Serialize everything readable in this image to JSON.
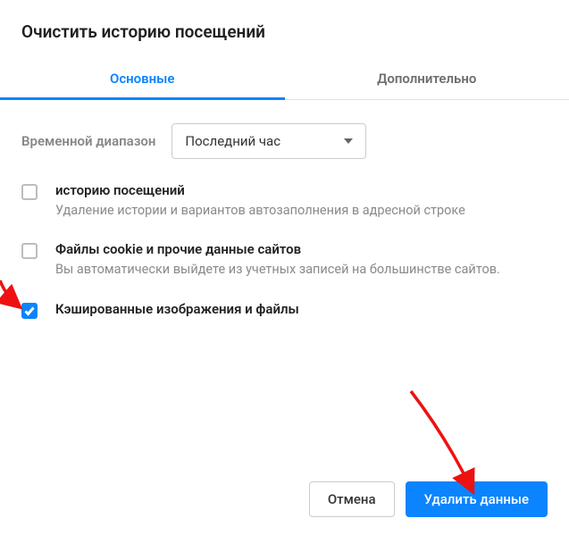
{
  "title": "Очистить историю посещений",
  "tabs": {
    "basic": "Основные",
    "advanced": "Дополнительно"
  },
  "range": {
    "label": "Временной диапазон",
    "selected": "Последний час"
  },
  "options": [
    {
      "title": "историю посещений",
      "desc": "Удаление истории и вариантов автозаполнения в адресной строке",
      "checked": false
    },
    {
      "title": "Файлы cookie и прочие данные сайтов",
      "desc": "Вы автоматически выйдете из учетных записей на большинстве сайтов.",
      "checked": false
    },
    {
      "title": "Кэшированные изображения и файлы",
      "desc": "",
      "checked": true
    }
  ],
  "buttons": {
    "cancel": "Отмена",
    "confirm": "Удалить данные"
  }
}
